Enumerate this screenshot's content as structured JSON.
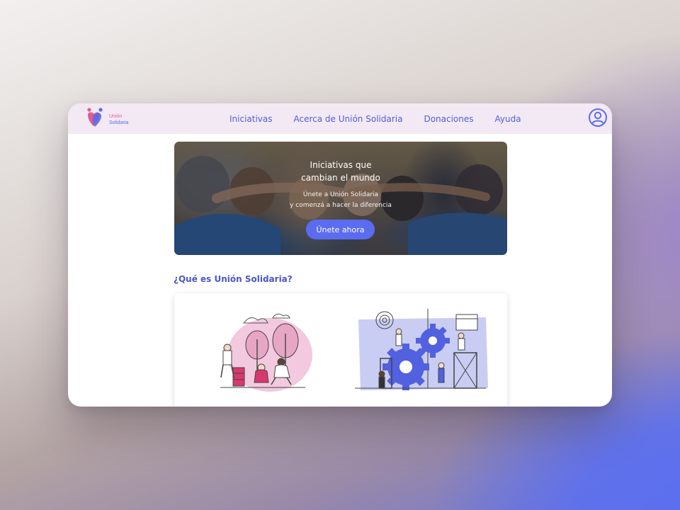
{
  "brand": {
    "name_line1": "Unión",
    "name_line2": "Solidaria",
    "colors": {
      "pink": "#e25a8f",
      "blue": "#5a6ae8"
    }
  },
  "nav": {
    "items": [
      {
        "label": "Iniciativas"
      },
      {
        "label": "Acerca de Unión Solidaria"
      },
      {
        "label": "Donaciones"
      },
      {
        "label": "Ayuda"
      }
    ],
    "profile_icon": "user-circle-icon"
  },
  "hero": {
    "title": "Iniciativas que\ncambian el mundo",
    "subtitle": "Únete a Unión Solidaria\ny comenzá a hacer la diferencia",
    "cta_label": "Únete ahora"
  },
  "about": {
    "title": "¿Qué es Unión Solidaria?",
    "illustrations": [
      "volunteers-planting-illustration",
      "teamwork-gears-illustration"
    ]
  },
  "colors": {
    "accent": "#5b6cf0",
    "nav_bg": "#f3e9f4",
    "title": "#4a56c8"
  }
}
